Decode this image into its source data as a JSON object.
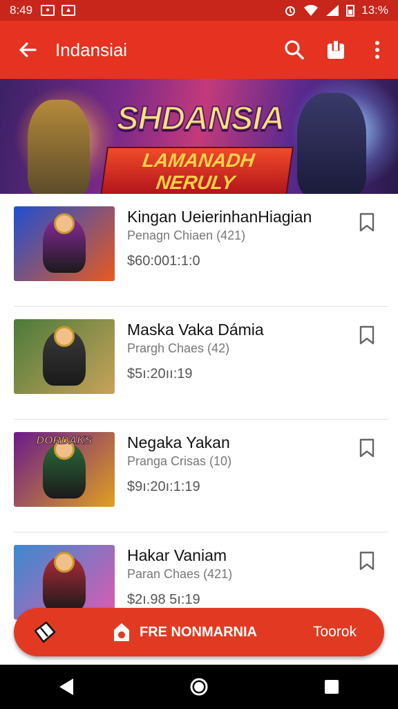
{
  "status_bar": {
    "time": "8:49",
    "battery": "13:%"
  },
  "app_bar": {
    "title": "Indansiai"
  },
  "banner": {
    "headline": "SHDANSIA",
    "subline": "LAMANADH NERULY"
  },
  "items": [
    {
      "name": "Kingan UeierinhanHiagian",
      "subtitle": "Penagn Chiaen (421)",
      "price": "$60:001:1:0",
      "thumb": {
        "bg1": "#1e4fd1",
        "bg2": "#e85a1f",
        "char": "#8a2a9a",
        "label": ""
      }
    },
    {
      "name": "Maska Vaka Dámia",
      "subtitle": "Prargh Chaes (42)",
      "price": "$5ı:20ıı:19",
      "thumb": {
        "bg1": "#4a7a3a",
        "bg2": "#c9a35a",
        "char": "#3a3a3a",
        "label": ""
      }
    },
    {
      "name": "Negaka Yakan",
      "subtitle": "Pranga Crisas (10)",
      "price": "$9ı:20ı:1:19",
      "thumb": {
        "bg1": "#6a1a8a",
        "bg2": "#e0a020",
        "char": "#2a6a3a",
        "label": "DORDAKS"
      }
    },
    {
      "name": "Hakar Vaniam",
      "subtitle": "Paran Chaes (421)",
      "price": "$2ı.98 5ı:19",
      "thumb": {
        "bg1": "#3a8ad0",
        "bg2": "#e05ab0",
        "char": "#b02a3a",
        "label": ""
      }
    }
  ],
  "bottom_action": {
    "cta_label": "FRE NONMARNIA",
    "right_label": "Toorok"
  },
  "colors": {
    "primary": "#e53221",
    "status": "#c8261b"
  }
}
